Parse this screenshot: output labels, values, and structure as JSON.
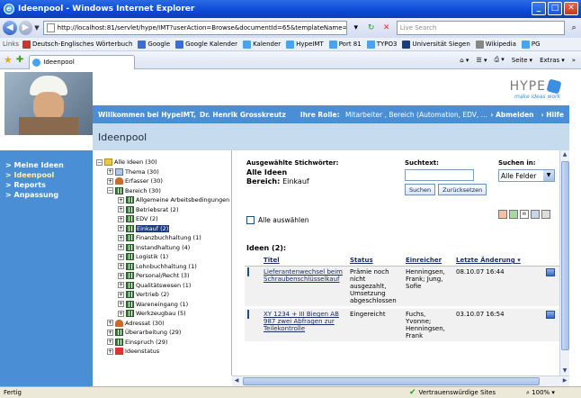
{
  "window": {
    "title": "Ideenpool - Windows Internet Explorer",
    "min": "_",
    "max": "□",
    "close": "✕"
  },
  "address": {
    "url": "http://localhost:81/servlet/hype/IMT?userAction=Browse&documentId=65&templateName=SucheFramesOhneKopfzeile&ses",
    "search_placeholder": "Live Search"
  },
  "links": {
    "label": "Links",
    "items": [
      {
        "label": "Deutsch-Englisches Wörterbuch",
        "color": "#c23a2a"
      },
      {
        "label": "Google",
        "color": "#3a6fd8"
      },
      {
        "label": "Google Kalender",
        "color": "#3a6fd8"
      },
      {
        "label": "Kalender",
        "color": "#4aa3ef"
      },
      {
        "label": "HypeIMT",
        "color": "#4aa3ef"
      },
      {
        "label": "Port 81",
        "color": "#4aa3ef"
      },
      {
        "label": "TYPO3",
        "color": "#4aa3ef"
      },
      {
        "label": "Universität Siegen",
        "color": "#1b3b87"
      },
      {
        "label": "Wikipedia",
        "color": "#888888"
      },
      {
        "label": "PG",
        "color": "#4aa3ef"
      }
    ]
  },
  "tab": {
    "label": "Ideenpool"
  },
  "commandbar": {
    "seite": "Seite",
    "extras": "Extras"
  },
  "header": {
    "logo": "HYPE",
    "tagline": "make ideas work",
    "welcome": "Willkommen bei HypeIMT,",
    "user": "Dr. Henrik Grosskreutz",
    "role_label": "Ihre Rolle:",
    "role_value": "Mitarbeiter , Bereich (Automation, EDV, ...",
    "logout": "Abmelden",
    "help": "Hilfe",
    "page_title": "Ideenpool"
  },
  "leftnav": {
    "items": [
      {
        "label": "Meine Ideen",
        "active": false
      },
      {
        "label": "Ideenpool",
        "active": true
      },
      {
        "label": "Reports",
        "active": false
      },
      {
        "label": "Anpassung",
        "active": false
      }
    ]
  },
  "tree": {
    "root": "Alle Ideen (30)",
    "nodes": [
      {
        "label": "Thema (30)",
        "level": 1,
        "exp": "+",
        "icon": "doc"
      },
      {
        "label": "Erfasser (30)",
        "level": 1,
        "exp": "+",
        "icon": "user"
      },
      {
        "label": "Bereich (30)",
        "level": 1,
        "exp": "-",
        "icon": "grid"
      },
      {
        "label": "Allgemeine Arbeitsbedingungen (5)",
        "level": 2,
        "exp": "+",
        "icon": "grid"
      },
      {
        "label": "Betriebsrat (2)",
        "level": 2,
        "exp": "+",
        "icon": "grid"
      },
      {
        "label": "EDV (2)",
        "level": 2,
        "exp": "+",
        "icon": "grid"
      },
      {
        "label": "Einkauf (2)",
        "level": 2,
        "exp": "+",
        "icon": "grid",
        "selected": true
      },
      {
        "label": "Finanzbuchhaltung (1)",
        "level": 2,
        "exp": "+",
        "icon": "grid"
      },
      {
        "label": "Instandhaltung (4)",
        "level": 2,
        "exp": "+",
        "icon": "grid"
      },
      {
        "label": "Logistik (1)",
        "level": 2,
        "exp": "+",
        "icon": "grid"
      },
      {
        "label": "Lohnbuchhaltung (1)",
        "level": 2,
        "exp": "+",
        "icon": "grid"
      },
      {
        "label": "Personal/Recht (3)",
        "level": 2,
        "exp": "+",
        "icon": "grid"
      },
      {
        "label": "Qualitätswesen (1)",
        "level": 2,
        "exp": "+",
        "icon": "grid"
      },
      {
        "label": "Vertrieb (2)",
        "level": 2,
        "exp": "+",
        "icon": "grid"
      },
      {
        "label": "Wareneingang (1)",
        "level": 2,
        "exp": "+",
        "icon": "grid"
      },
      {
        "label": "Werkzeugbau (5)",
        "level": 2,
        "exp": "+",
        "icon": "grid"
      },
      {
        "label": "Adressat (30)",
        "level": 1,
        "exp": "+",
        "icon": "user"
      },
      {
        "label": "Überarbeitung (29)",
        "level": 1,
        "exp": "+",
        "icon": "grid"
      },
      {
        "label": "Einspruch (29)",
        "level": 1,
        "exp": "+",
        "icon": "grid"
      },
      {
        "label": "Ideenstatus",
        "level": 1,
        "exp": "+",
        "icon": "flag"
      }
    ]
  },
  "filter": {
    "heading": "Ausgewählte Stichwörter:",
    "line1": "Alle Ideen",
    "line2_label": "Bereich:",
    "line2_value": "Einkauf"
  },
  "search": {
    "label": "Suchtext:",
    "value": "",
    "search_btn": "Suchen",
    "reset_btn": "Zurücksetzen",
    "in_label": "Suchen in:",
    "in_value": "Alle Felder"
  },
  "select_all": "Alle auswählen",
  "ideas": {
    "count_label": "Ideen (2):",
    "columns": [
      "Titel",
      "Status",
      "Einreicher",
      "Letzte Änderung"
    ],
    "rows": [
      {
        "title": "Lieferantenwechsel beim Schraubenschlüsselkauf",
        "status": "Prämie noch nicht ausgezahlt, Umsetzung abgeschlossen",
        "submitter": "Henningsen, Frank; Jung, Sofie",
        "changed": "08.10.07 16:44"
      },
      {
        "title": "XY 1234 + III Biegen AB 987 zwei Abfragen zur Teilekontrolle",
        "status": "Eingereicht",
        "submitter": "Fuchs, Yvonne; Henningsen, Frank",
        "changed": "03.10.07 16:54"
      }
    ]
  },
  "status": {
    "left": "Fertig",
    "trust": "Vertrauenswürdige Sites",
    "zoom": "100%"
  }
}
